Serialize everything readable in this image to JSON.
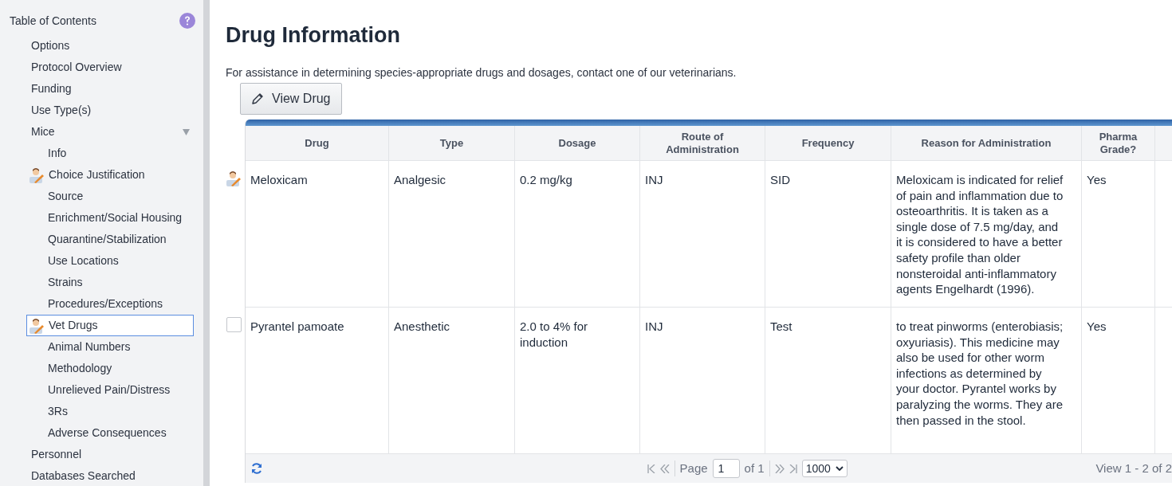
{
  "sidebar": {
    "title": "Table of Contents",
    "items": [
      {
        "label": "Options",
        "edited": false,
        "selected": false
      },
      {
        "label": "Protocol Overview",
        "edited": false,
        "selected": false
      },
      {
        "label": "Funding",
        "edited": false,
        "selected": false
      },
      {
        "label": "Use Type(s)",
        "edited": false,
        "selected": false
      },
      {
        "label": "Mice",
        "edited": false,
        "selected": false,
        "expanded": true,
        "children": [
          {
            "label": "Info",
            "edited": false,
            "selected": false
          },
          {
            "label": "Choice Justification",
            "edited": true,
            "selected": false
          },
          {
            "label": "Source",
            "edited": false,
            "selected": false
          },
          {
            "label": "Enrichment/Social Housing",
            "edited": false,
            "selected": false
          },
          {
            "label": "Quarantine/Stabilization",
            "edited": false,
            "selected": false
          },
          {
            "label": "Use Locations",
            "edited": false,
            "selected": false
          },
          {
            "label": "Strains",
            "edited": false,
            "selected": false
          },
          {
            "label": "Procedures/Exceptions",
            "edited": false,
            "selected": false
          },
          {
            "label": "Vet Drugs",
            "edited": true,
            "selected": true
          },
          {
            "label": "Animal Numbers",
            "edited": false,
            "selected": false
          },
          {
            "label": "Methodology",
            "edited": false,
            "selected": false
          },
          {
            "label": "Unrelieved Pain/Distress",
            "edited": false,
            "selected": false
          },
          {
            "label": "3Rs",
            "edited": false,
            "selected": false
          },
          {
            "label": "Adverse Consequences",
            "edited": false,
            "selected": false
          }
        ]
      },
      {
        "label": "Personnel",
        "edited": false,
        "selected": false
      },
      {
        "label": "Databases Searched",
        "edited": false,
        "selected": false
      }
    ]
  },
  "page": {
    "title": "Drug Information",
    "intro": "For assistance in determining species-appropriate drugs and dosages, contact one of our veterinarians.",
    "view_button": "View Drug"
  },
  "table": {
    "columns": [
      "Drug",
      "Type",
      "Dosage",
      "Route of Administration",
      "Frequency",
      "Reason for Administration",
      "Pharma Grade?"
    ],
    "rows": [
      {
        "kind": "edited",
        "cells": [
          "Meloxicam",
          "Analgesic",
          "0.2 mg/kg",
          "INJ",
          "SID",
          "Meloxicam is indicated for relief of pain and inflammation due to osteoarthritis. It is taken as a single dose of 7.5 mg/day, and it is considered to have a better safety profile than older nonsteroidal anti-inflammatory agents Engelhardt (1996).",
          "Yes"
        ]
      },
      {
        "kind": "checkbox",
        "checked": false,
        "cells": [
          "Pyrantel pamoate",
          "Anesthetic",
          "2.0 to 4% for induction",
          "INJ",
          "Test",
          "to treat pinworms (enterobiasis; oxyuriasis). This medicine may also be used for other worm infections as determined by your doctor. Pyrantel works by paralyzing the worms. They are then passed in the stool.",
          "Yes"
        ]
      }
    ]
  },
  "pager": {
    "page_label": "Page",
    "page": "1",
    "of": "of 1",
    "page_size": "1000",
    "summary": "View 1 - 2 of 2"
  }
}
